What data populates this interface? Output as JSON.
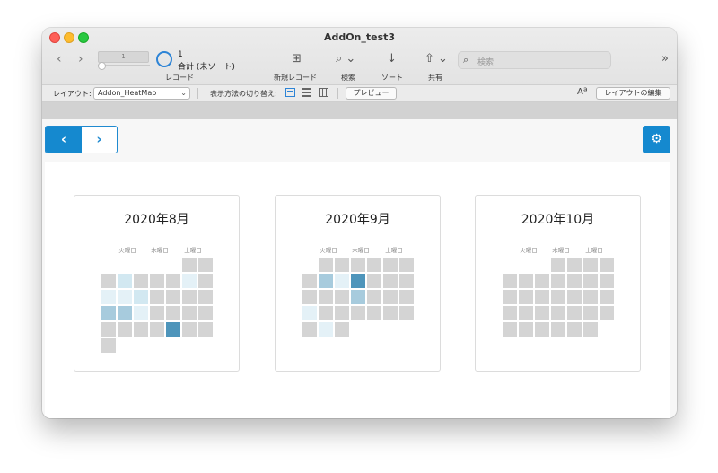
{
  "window": {
    "title": "AddOn_test3"
  },
  "toolbar": {
    "record_field_value": "1",
    "record_count": "1",
    "record_status": "合計 (未ソート)",
    "records_label": "レコード",
    "new_record_label": "新規レコード",
    "find_label": "検索",
    "sort_label": "ソート",
    "share_label": "共有",
    "search_placeholder": "検索"
  },
  "layoutbar": {
    "layout_label": "レイアウト:",
    "layout_value": "Addon_HeatMap",
    "view_as_label": "表示方法の切り替え:",
    "preview_label": "プレビュー",
    "edit_layout_label": "レイアウトの編集"
  },
  "calendars": [
    {
      "title": "2020年8月",
      "weekday_labels": [
        "火曜日",
        "木曜日",
        "土曜日"
      ],
      "cells": [
        {
          "c": 5,
          "r": 0,
          "l": 0
        },
        {
          "c": 6,
          "r": 0,
          "l": 0
        },
        {
          "c": 0,
          "r": 1,
          "l": 0
        },
        {
          "c": 1,
          "r": 1,
          "l": 2
        },
        {
          "c": 2,
          "r": 1,
          "l": 0
        },
        {
          "c": 3,
          "r": 1,
          "l": 0
        },
        {
          "c": 4,
          "r": 1,
          "l": 0
        },
        {
          "c": 5,
          "r": 1,
          "l": 1
        },
        {
          "c": 6,
          "r": 1,
          "l": 0
        },
        {
          "c": 0,
          "r": 2,
          "l": 1
        },
        {
          "c": 1,
          "r": 2,
          "l": 1
        },
        {
          "c": 2,
          "r": 2,
          "l": 2
        },
        {
          "c": 3,
          "r": 2,
          "l": 0
        },
        {
          "c": 4,
          "r": 2,
          "l": 0
        },
        {
          "c": 5,
          "r": 2,
          "l": 0
        },
        {
          "c": 6,
          "r": 2,
          "l": 0
        },
        {
          "c": 0,
          "r": 3,
          "l": 3
        },
        {
          "c": 1,
          "r": 3,
          "l": 3
        },
        {
          "c": 2,
          "r": 3,
          "l": 1
        },
        {
          "c": 3,
          "r": 3,
          "l": 0
        },
        {
          "c": 4,
          "r": 3,
          "l": 0
        },
        {
          "c": 5,
          "r": 3,
          "l": 0
        },
        {
          "c": 6,
          "r": 3,
          "l": 0
        },
        {
          "c": 0,
          "r": 4,
          "l": 0
        },
        {
          "c": 1,
          "r": 4,
          "l": 0
        },
        {
          "c": 2,
          "r": 4,
          "l": 0
        },
        {
          "c": 3,
          "r": 4,
          "l": 0
        },
        {
          "c": 4,
          "r": 4,
          "l": 4
        },
        {
          "c": 5,
          "r": 4,
          "l": 0
        },
        {
          "c": 6,
          "r": 4,
          "l": 0
        },
        {
          "c": 0,
          "r": 5,
          "l": 0
        }
      ]
    },
    {
      "title": "2020年9月",
      "weekday_labels": [
        "火曜日",
        "木曜日",
        "土曜日"
      ],
      "cells": [
        {
          "c": 1,
          "r": 0,
          "l": 0
        },
        {
          "c": 2,
          "r": 0,
          "l": 0
        },
        {
          "c": 3,
          "r": 0,
          "l": 0
        },
        {
          "c": 4,
          "r": 0,
          "l": 0
        },
        {
          "c": 5,
          "r": 0,
          "l": 0
        },
        {
          "c": 6,
          "r": 0,
          "l": 0
        },
        {
          "c": 0,
          "r": 1,
          "l": 0
        },
        {
          "c": 1,
          "r": 1,
          "l": 3
        },
        {
          "c": 2,
          "r": 1,
          "l": 1
        },
        {
          "c": 3,
          "r": 1,
          "l": 4
        },
        {
          "c": 4,
          "r": 1,
          "l": 0
        },
        {
          "c": 5,
          "r": 1,
          "l": 0
        },
        {
          "c": 6,
          "r": 1,
          "l": 0
        },
        {
          "c": 0,
          "r": 2,
          "l": 0
        },
        {
          "c": 1,
          "r": 2,
          "l": 0
        },
        {
          "c": 2,
          "r": 2,
          "l": 0
        },
        {
          "c": 3,
          "r": 2,
          "l": 3
        },
        {
          "c": 4,
          "r": 2,
          "l": 0
        },
        {
          "c": 5,
          "r": 2,
          "l": 0
        },
        {
          "c": 6,
          "r": 2,
          "l": 0
        },
        {
          "c": 0,
          "r": 3,
          "l": 1
        },
        {
          "c": 1,
          "r": 3,
          "l": 0
        },
        {
          "c": 2,
          "r": 3,
          "l": 0
        },
        {
          "c": 3,
          "r": 3,
          "l": 0
        },
        {
          "c": 4,
          "r": 3,
          "l": 0
        },
        {
          "c": 5,
          "r": 3,
          "l": 0
        },
        {
          "c": 6,
          "r": 3,
          "l": 0
        },
        {
          "c": 0,
          "r": 4,
          "l": 0
        },
        {
          "c": 1,
          "r": 4,
          "l": 1
        },
        {
          "c": 2,
          "r": 4,
          "l": 0
        }
      ]
    },
    {
      "title": "2020年10月",
      "weekday_labels": [
        "火曜日",
        "木曜日",
        "土曜日"
      ],
      "cells": [
        {
          "c": 3,
          "r": 0,
          "l": 0
        },
        {
          "c": 4,
          "r": 0,
          "l": 0
        },
        {
          "c": 5,
          "r": 0,
          "l": 0
        },
        {
          "c": 6,
          "r": 0,
          "l": 0
        },
        {
          "c": 0,
          "r": 1,
          "l": 0
        },
        {
          "c": 1,
          "r": 1,
          "l": 0
        },
        {
          "c": 2,
          "r": 1,
          "l": 0
        },
        {
          "c": 3,
          "r": 1,
          "l": 0
        },
        {
          "c": 4,
          "r": 1,
          "l": 0
        },
        {
          "c": 5,
          "r": 1,
          "l": 0
        },
        {
          "c": 6,
          "r": 1,
          "l": 0
        },
        {
          "c": 0,
          "r": 2,
          "l": 0
        },
        {
          "c": 1,
          "r": 2,
          "l": 0
        },
        {
          "c": 2,
          "r": 2,
          "l": 0
        },
        {
          "c": 3,
          "r": 2,
          "l": 0
        },
        {
          "c": 4,
          "r": 2,
          "l": 0
        },
        {
          "c": 5,
          "r": 2,
          "l": 0
        },
        {
          "c": 6,
          "r": 2,
          "l": 0
        },
        {
          "c": 0,
          "r": 3,
          "l": 0
        },
        {
          "c": 1,
          "r": 3,
          "l": 0
        },
        {
          "c": 2,
          "r": 3,
          "l": 0
        },
        {
          "c": 3,
          "r": 3,
          "l": 0
        },
        {
          "c": 4,
          "r": 3,
          "l": 0
        },
        {
          "c": 5,
          "r": 3,
          "l": 0
        },
        {
          "c": 6,
          "r": 3,
          "l": 0
        },
        {
          "c": 0,
          "r": 4,
          "l": 0
        },
        {
          "c": 1,
          "r": 4,
          "l": 0
        },
        {
          "c": 2,
          "r": 4,
          "l": 0
        },
        {
          "c": 3,
          "r": 4,
          "l": 0
        },
        {
          "c": 4,
          "r": 4,
          "l": 0
        },
        {
          "c": 5,
          "r": 4,
          "l": 0
        }
      ]
    }
  ],
  "colors": {
    "accent": "#1589cf",
    "empty_cell": "#d4d4d4",
    "heat_levels": [
      "#e4f1f7",
      "#d2e8f1",
      "#a7cbdd",
      "#4e95bb"
    ]
  }
}
